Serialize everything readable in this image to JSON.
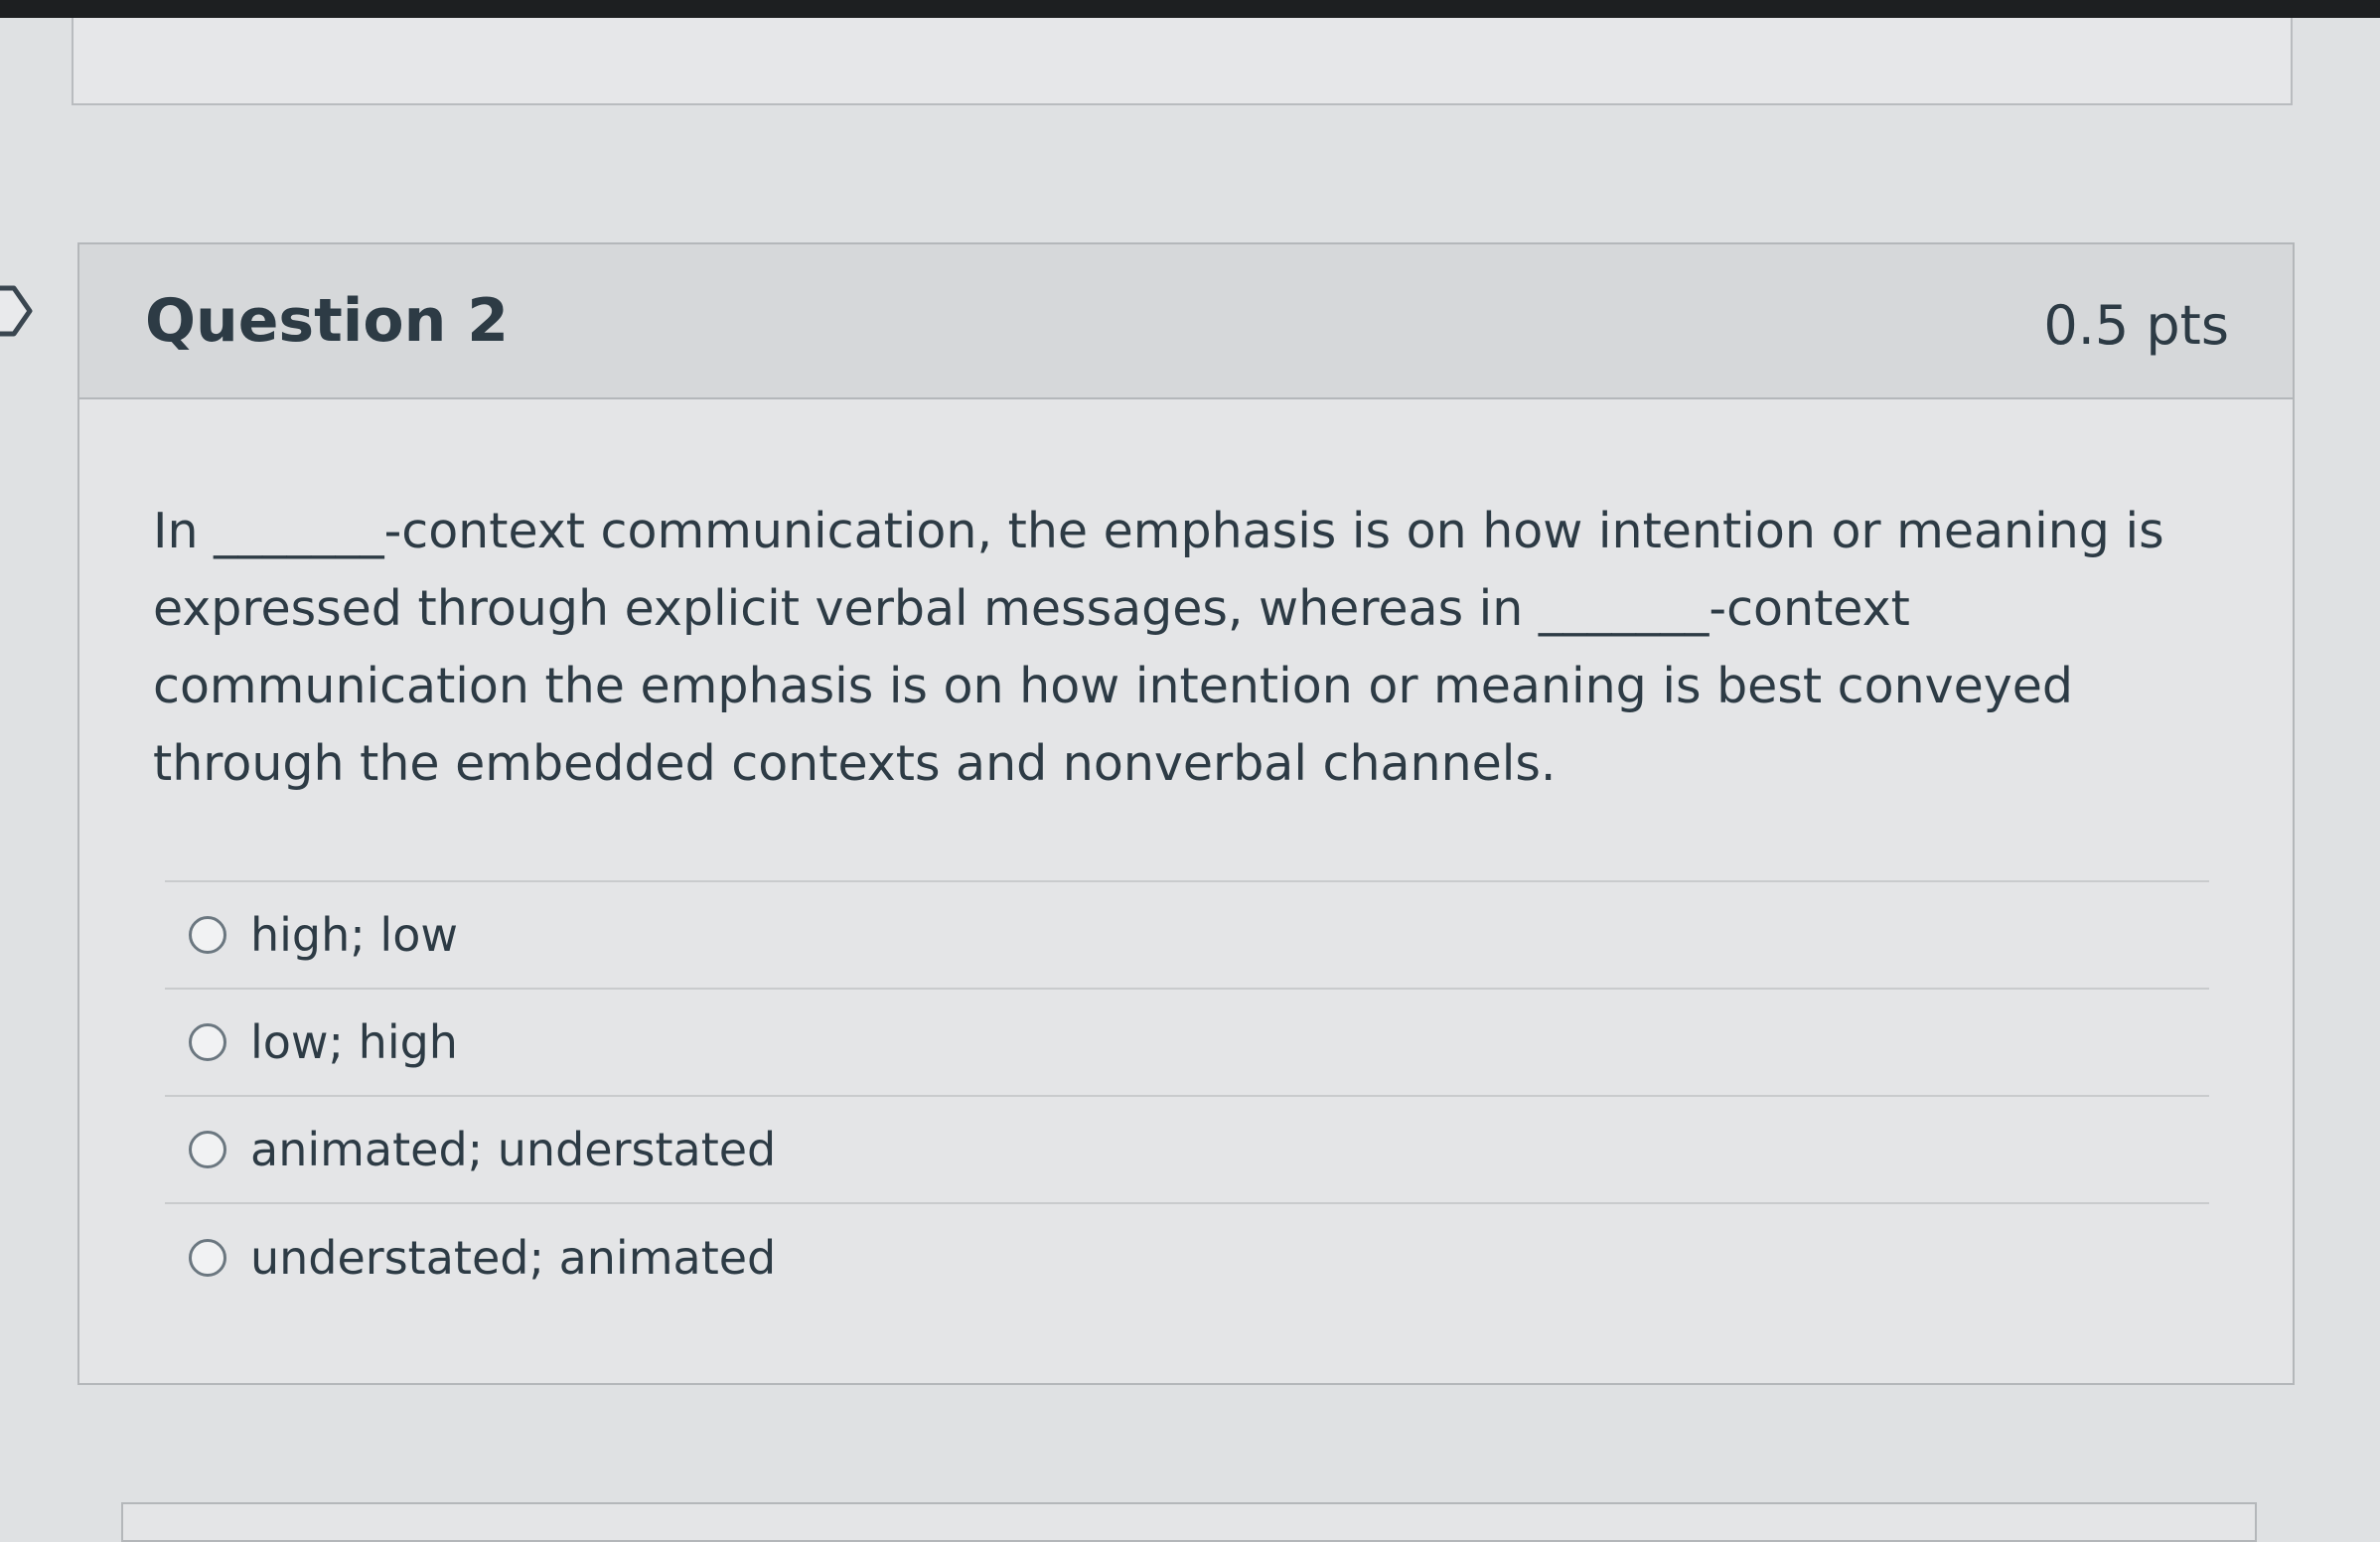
{
  "question": {
    "title": "Question 2",
    "points": "0.5 pts",
    "text": "In _______-context communication, the emphasis is on how intention or meaning is expressed through explicit verbal messages, whereas in _______-context communication the emphasis is on how intention or meaning is best conveyed through the embedded contexts and nonverbal channels.",
    "answers": [
      {
        "label": "high; low"
      },
      {
        "label": "low; high"
      },
      {
        "label": "animated; understated"
      },
      {
        "label": "understated; animated"
      }
    ]
  },
  "icons": {
    "flag": "bookmark-flag-icon",
    "radio": "radio-button-unselected-icon"
  }
}
